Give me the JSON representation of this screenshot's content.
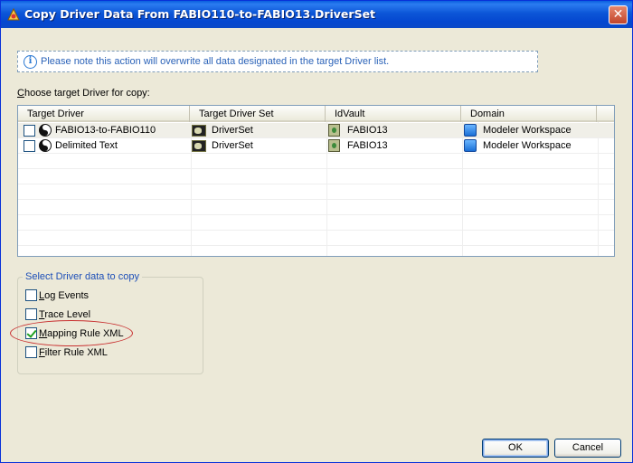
{
  "window": {
    "title": "Copy Driver Data From FABIO110-to-FABIO13.DriverSet",
    "close_glyph": "✕"
  },
  "info": {
    "text": "Please note this action will overwrite all data designated in the target Driver list."
  },
  "choose_label": {
    "mnemonic": "C",
    "rest": "hoose target Driver for copy:"
  },
  "table": {
    "columns": [
      "Target Driver",
      "Target Driver Set",
      "IdVault",
      "Domain"
    ],
    "rows": [
      {
        "checked": false,
        "driver": "FABIO13-to-FABIO110",
        "driver_set": "DriverSet",
        "idvault": "FABIO13",
        "domain": "Modeler Workspace"
      },
      {
        "checked": false,
        "driver": "Delimited Text",
        "driver_set": "DriverSet",
        "idvault": "FABIO13",
        "domain": "Modeler Workspace"
      }
    ]
  },
  "data_group": {
    "legend": "Select Driver data to copy",
    "options": [
      {
        "mnemonic": "L",
        "rest": "og Events",
        "checked": false
      },
      {
        "mnemonic": "T",
        "rest": "race Level",
        "checked": false
      },
      {
        "mnemonic": "M",
        "rest": "apping Rule XML",
        "checked": true
      },
      {
        "mnemonic": "F",
        "rest": "ilter Rule XML",
        "checked": false
      }
    ]
  },
  "buttons": {
    "ok": "OK",
    "cancel": "Cancel"
  },
  "colors": {
    "titlebar": "#0a54d6",
    "info_text": "#2a62b8",
    "group_legend": "#1d4fb8",
    "highlight_ring": "#c83030"
  },
  "icons": {
    "title": "copy-driver-icon",
    "info": "info-icon",
    "driver": "yin-yang-driver-icon",
    "driver_set": "driverset-icon",
    "idvault": "idvault-icon",
    "domain": "domain-icon"
  }
}
